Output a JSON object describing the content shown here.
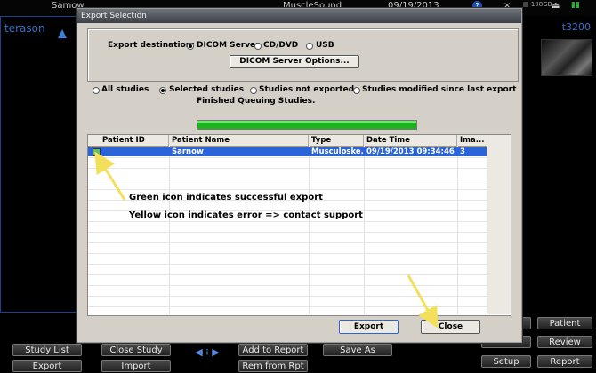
{
  "app": {
    "patient_name": "Samow",
    "exam": "MuscleSound",
    "date": "09/19/2013",
    "brand": "terason",
    "model": "t3200",
    "status_icons": [
      "?",
      "×",
      "⏏"
    ]
  },
  "dialog": {
    "title": "Export Selection",
    "destination_label": "Export destination:",
    "destinations": [
      {
        "label": "DICOM Server",
        "selected": true
      },
      {
        "label": "CD/DVD",
        "selected": false
      },
      {
        "label": "USB",
        "selected": false
      }
    ],
    "dicom_options_label": "DICOM Server Options...",
    "study_filters": [
      {
        "label": "All studies",
        "selected": false
      },
      {
        "label": "Selected studies",
        "selected": true
      },
      {
        "label": "Studies not exported",
        "selected": false
      },
      {
        "label": "Studies modified since last export",
        "selected": false
      }
    ],
    "status_text": "Finished Queuing Studies.",
    "progress": 1.0,
    "columns": [
      "Patient ID",
      "Patient Name",
      "Type",
      "Date Time",
      "Ima..."
    ],
    "rows": [
      {
        "patient_id": "",
        "patient_name": "Sarnow",
        "type": "Musculoske...",
        "date_time": "09/19/2013 09:34:46",
        "images": "3",
        "status": "success"
      }
    ],
    "annotation_green": "Green icon indicates successful export",
    "annotation_yellow": "Yellow icon indicates error => contact support",
    "export_label": "Export",
    "close_label": "Close"
  },
  "bottom_buttons": {
    "study_list": "Study List",
    "export": "Export",
    "close_study": "Close Study",
    "import": "Import",
    "add_to_report": "Add to Report",
    "rem_from_rpt": "Rem from Rpt",
    "save_as": "Save As",
    "setup": "Setup",
    "patient": "Patient",
    "review": "Review",
    "report": "Report"
  },
  "colors": {
    "accent_blue": "#2b64d8",
    "progress_green": "#1db31d",
    "arrow_yellow": "#f2e05a"
  }
}
